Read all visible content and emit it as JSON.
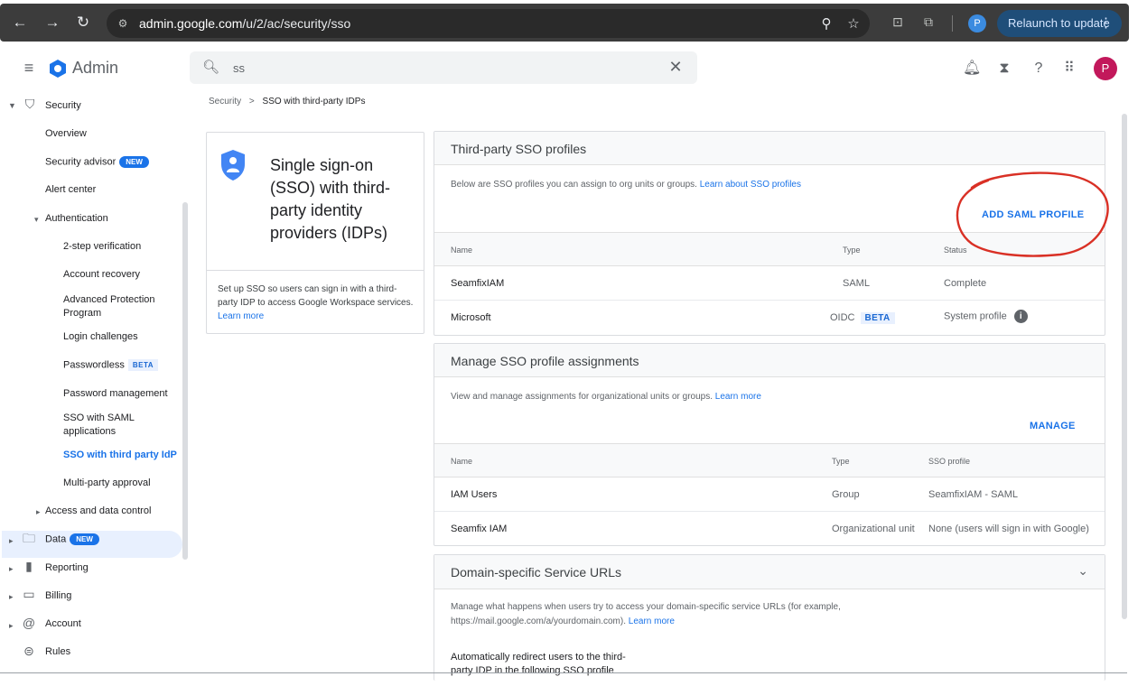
{
  "browser": {
    "url_host": "admin.google.com",
    "url_path": "/u/2/ac/security/sso",
    "profile_initial": "P",
    "relaunch_label": "Relaunch to update"
  },
  "header": {
    "app_title": "Admin",
    "search_value": "ss",
    "avatar_initial": "P"
  },
  "sidebar": {
    "security": "Security",
    "overview": "Overview",
    "security_advisor": "Security advisor",
    "new_badge": "NEW",
    "alert_center": "Alert center",
    "authentication": "Authentication",
    "two_step": "2-step verification",
    "account_recovery": "Account recovery",
    "advanced_protection_1": "Advanced Protection",
    "advanced_protection_2": "Program",
    "login_challenges": "Login challenges",
    "passwordless": "Passwordless",
    "beta_badge": "BETA",
    "password_management": "Password management",
    "sso_saml_1": "SSO with SAML",
    "sso_saml_2": "applications",
    "sso_third_party": "SSO with third party IdP",
    "multi_party": "Multi-party approval",
    "access_data": "Access and data control",
    "data": "Data",
    "reporting": "Reporting",
    "billing": "Billing",
    "account": "Account",
    "rules": "Rules"
  },
  "breadcrumb": {
    "parent": "Security",
    "separator": ">",
    "current": "SSO with third-party IDPs"
  },
  "info_card": {
    "title": "Single sign-on (SSO) with third-party identity providers (IDPs)",
    "desc": "Set up SSO so users can sign in with a third-party IDP to access Google Workspace services.",
    "learn_more": "Learn more"
  },
  "sso_profiles": {
    "heading": "Third-party SSO profiles",
    "desc": "Below are SSO profiles you can assign to org units or groups.",
    "learn_link": "Learn about SSO profiles",
    "add_button": "ADD SAML PROFILE",
    "columns": [
      "Name",
      "Type",
      "Status"
    ],
    "rows": [
      {
        "name": "SeamfixIAM",
        "type": "SAML",
        "status": "Complete"
      },
      {
        "name": "Microsoft",
        "type": "OIDC",
        "badge": "BETA",
        "status": "System profile"
      }
    ]
  },
  "assignments": {
    "heading": "Manage SSO profile assignments",
    "desc": "View and manage assignments for organizational units or groups.",
    "learn_more": "Learn more",
    "manage_button": "MANAGE",
    "columns": [
      "Name",
      "Type",
      "SSO profile"
    ],
    "rows": [
      {
        "name": "IAM Users",
        "type": "Group",
        "profile": "SeamfixIAM - SAML"
      },
      {
        "name": "Seamfix IAM",
        "type": "Organizational unit",
        "profile": "None (users will sign in with Google)"
      }
    ]
  },
  "domain_urls": {
    "heading": "Domain-specific Service URLs",
    "desc_1": "Manage what happens when users try to access your domain-specific service URLs (for example,",
    "desc_2": "https://mail.google.com/a/yourdomain.com).",
    "learn_more": "Learn more",
    "redirect_1": "Automatically redirect users to the third-",
    "redirect_2": "party IDP in the following SSO profile"
  },
  "colors": {
    "accent": "#1a73e8",
    "annotation": "#d93025",
    "avatar": "#c2185b"
  }
}
